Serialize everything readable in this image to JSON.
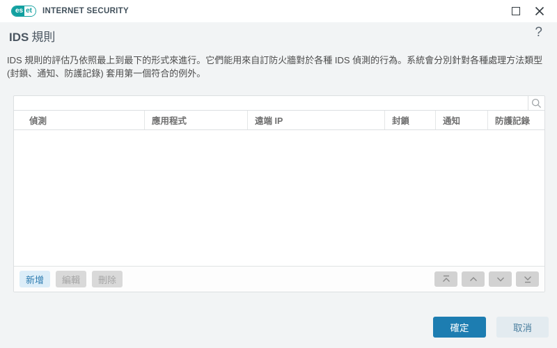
{
  "brand": {
    "logo_left": "es",
    "logo_right": "et",
    "product": "INTERNET SECURITY"
  },
  "window_controls": {
    "maximize_icon": "square-outline",
    "close_icon": "x-cross"
  },
  "page": {
    "title_en": "IDS",
    "title_zh": "規則",
    "help_label": "?",
    "description": "IDS 規則的評估乃依照最上到最下的形式來進行。它們能用來自訂防火牆對於各種 IDS 偵測的行為。系統會分別針對各種處理方法類型 (封鎖、通知、防護記錄) 套用第一個符合的例外。"
  },
  "search": {
    "value": "",
    "icon": "magnifier"
  },
  "table": {
    "columns": [
      {
        "label": "偵測"
      },
      {
        "label": "應用程式"
      },
      {
        "label": "遠端 IP"
      },
      {
        "label": "封鎖"
      },
      {
        "label": "通知"
      },
      {
        "label": "防護記錄"
      }
    ],
    "rows": []
  },
  "toolbar": {
    "add_label": "新增",
    "edit_label": "編輯",
    "delete_label": "刪除",
    "edit_enabled": false,
    "delete_enabled": false
  },
  "reorder_icons": [
    "move-to-top",
    "move-up",
    "move-down",
    "move-to-bottom"
  ],
  "dialog_actions": {
    "ok_label": "確定",
    "cancel_label": "取消"
  },
  "colors": {
    "brand_teal": "#12a0a0",
    "body_background": "#f2f4f5",
    "accent_blue": "#1d7db1",
    "add_button_bg": "#dcedf8",
    "add_button_text": "#2e7cb0",
    "disabled_bg": "#d9d9d9",
    "disabled_text": "#a6a6a6",
    "cancel_bg": "#e3ebf0",
    "cancel_text": "#4a7f9f",
    "header_text": "#6f6f6f",
    "border": "#dcdfe1"
  }
}
